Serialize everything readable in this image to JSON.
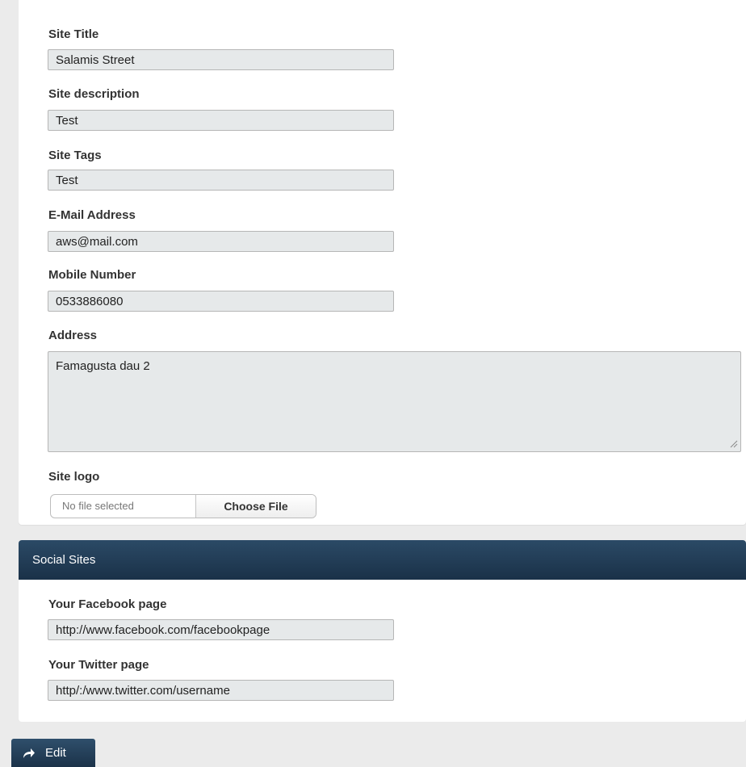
{
  "site": {
    "title_label": "Site Title",
    "title_value": "Salamis Street",
    "description_label": "Site description",
    "description_value": "Test",
    "tags_label": "Site Tags",
    "tags_value": "Test",
    "email_label": "E-Mail Address",
    "email_value": "aws@mail.com",
    "mobile_label": "Mobile Number",
    "mobile_value": "0533886080",
    "address_label": "Address",
    "address_value": "Famagusta dau 2",
    "logo_label": "Site logo",
    "logo_status": "No file selected",
    "logo_button": "Choose File"
  },
  "social": {
    "header": "Social Sites",
    "facebook_label": "Your Facebook page",
    "facebook_value": "http://www.facebook.com/facebookpage",
    "twitter_label": "Your Twitter page",
    "twitter_value": "http/:/www.twitter.com/username"
  },
  "actions": {
    "edit_label": "Edit",
    "edit_icon": "share-arrow-icon"
  },
  "colors": {
    "header_bg": "#1a3148",
    "field_bg": "#e6e9ea",
    "page_bg": "#ebebeb"
  }
}
